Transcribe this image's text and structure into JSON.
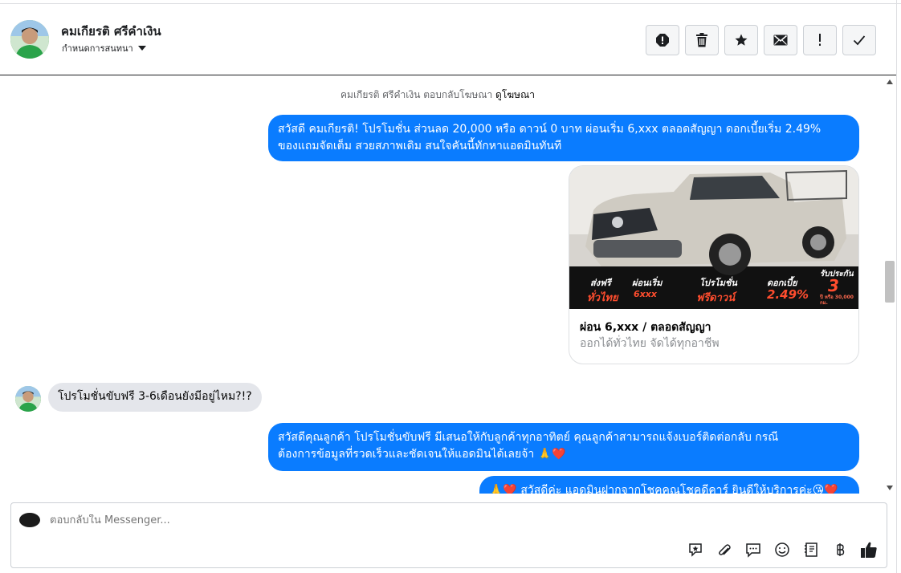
{
  "header": {
    "name": "คมเกียรติ ศรีคำเงิน",
    "subtitle": "กำหนดการสนทนา",
    "actions": [
      "report-icon",
      "trash-icon",
      "star-icon",
      "envelope-icon",
      "exclamation-icon",
      "check-icon"
    ]
  },
  "thread": {
    "notice_prefix": "คมเกียรติ ศรีคำเงิน ตอบกลับโฆษณา",
    "notice_link": "ดูโฆษณา",
    "messages": [
      {
        "direction": "out",
        "line1": "สวัสดี คมเกียรติ! โปรโมชั่น ส่วนลด 20,000 หรือ ดาวน์ 0 บาท ผ่อนเริ่ม 6,xxx ตลอดสัญญา ดอกเบี้ยเริ่ม 2.49%",
        "line2": "ของแถมจัดเต็ม สวยสภาพเดิม สนใจคันนี้ทักหาแอดมินทันที"
      },
      {
        "direction": "out",
        "type": "card",
        "promo": [
          {
            "label": "ส่งฟรี",
            "value": "ทั่วไทย"
          },
          {
            "label": "ผ่อนเริ่ม",
            "value": "6xxx"
          },
          {
            "label": "โปรโมชั่น",
            "value": "ฟรีดาวน์"
          },
          {
            "label": "ดอกเบี้ย",
            "value": "2.49%"
          },
          {
            "label": "รับประกัน",
            "value": "3",
            "extra": "ปี หรือ 30,000 กม."
          }
        ],
        "title": "ผ่อน 6,xxx / ตลอดสัญญา",
        "subtitle": "ออกได้ทั่วไทย จัดได้ทุกอาชีพ"
      },
      {
        "direction": "in",
        "text": "โปรโมชั่นขับฟรี 3-6เดือนยังมีอยู่ไหม?!?"
      },
      {
        "direction": "out",
        "line1": "สวัสดีคุณลูกค้า โปรโมชั่นขับฟรี มีเสนอให้กับลูกค้าทุกอาทิตย์ คุณลูกค้าสามารถแจ้งเบอร์ติดต่อกลับ กรณี",
        "line2": "ต้องการข้อมูลที่รวดเร็วและชัดเจนให้แอดมินได้เลยจ้า 🙏❤️"
      },
      {
        "direction": "out",
        "text": "🙏❤️ สวัสดีค่ะ แอดมินฝากจากโชคคูณโชคดีคาร์ ยินดีให้บริการค่ะ😘❤️"
      }
    ]
  },
  "composer": {
    "placeholder": "ตอบกลับใน Messenger...",
    "tools": [
      "sticker-icon",
      "paperclip-icon",
      "saved-replies-icon",
      "emoji-icon",
      "book-icon",
      "baht-icon",
      "like-icon"
    ]
  },
  "colors": {
    "outgoing_bubble": "#0a7cff",
    "incoming_bubble": "#e4e6eb",
    "text_muted": "#65676b"
  }
}
